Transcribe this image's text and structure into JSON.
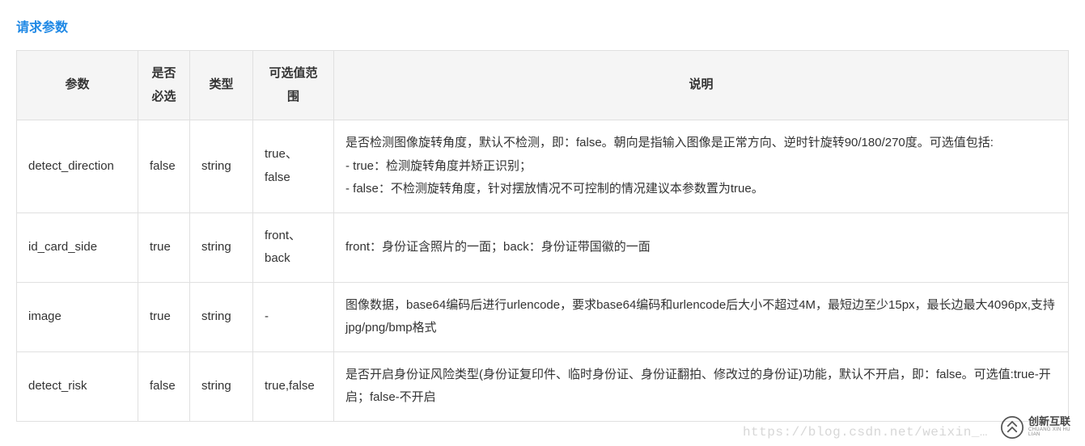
{
  "section_title": "请求参数",
  "headers": {
    "param": "参数",
    "required": "是否必选",
    "type": "类型",
    "range": "可选值范围",
    "desc": "说明"
  },
  "rows": [
    {
      "param": "detect_direction",
      "required": "false",
      "type": "string",
      "range": "true、false",
      "desc": "是否检测图像旋转角度，默认不检测，即：false。朝向是指输入图像是正常方向、逆时针旋转90/180/270度。可选值包括:\n- true：检测旋转角度并矫正识别；\n- false：不检测旋转角度，针对摆放情况不可控制的情况建议本参数置为true。"
    },
    {
      "param": "id_card_side",
      "required": "true",
      "type": "string",
      "range": "front、back",
      "desc": "front：身份证含照片的一面；back：身份证带国徽的一面"
    },
    {
      "param": "image",
      "required": "true",
      "type": "string",
      "range": "-",
      "desc": "图像数据，base64编码后进行urlencode，要求base64编码和urlencode后大小不超过4M，最短边至少15px，最长边最大4096px,支持jpg/png/bmp格式"
    },
    {
      "param": "detect_risk",
      "required": "false",
      "type": "string",
      "range": "true,false",
      "desc": "是否开启身份证风险类型(身份证复印件、临时身份证、身份证翻拍、修改过的身份证)功能，默认不开启，即：false。可选值:true-开启；false-不开启"
    }
  ],
  "watermark": {
    "url": "https://blog.csdn.net/weixin_…",
    "logo_cn": "创新互联",
    "logo_en": "CHUANG XIN HU LIAN"
  }
}
